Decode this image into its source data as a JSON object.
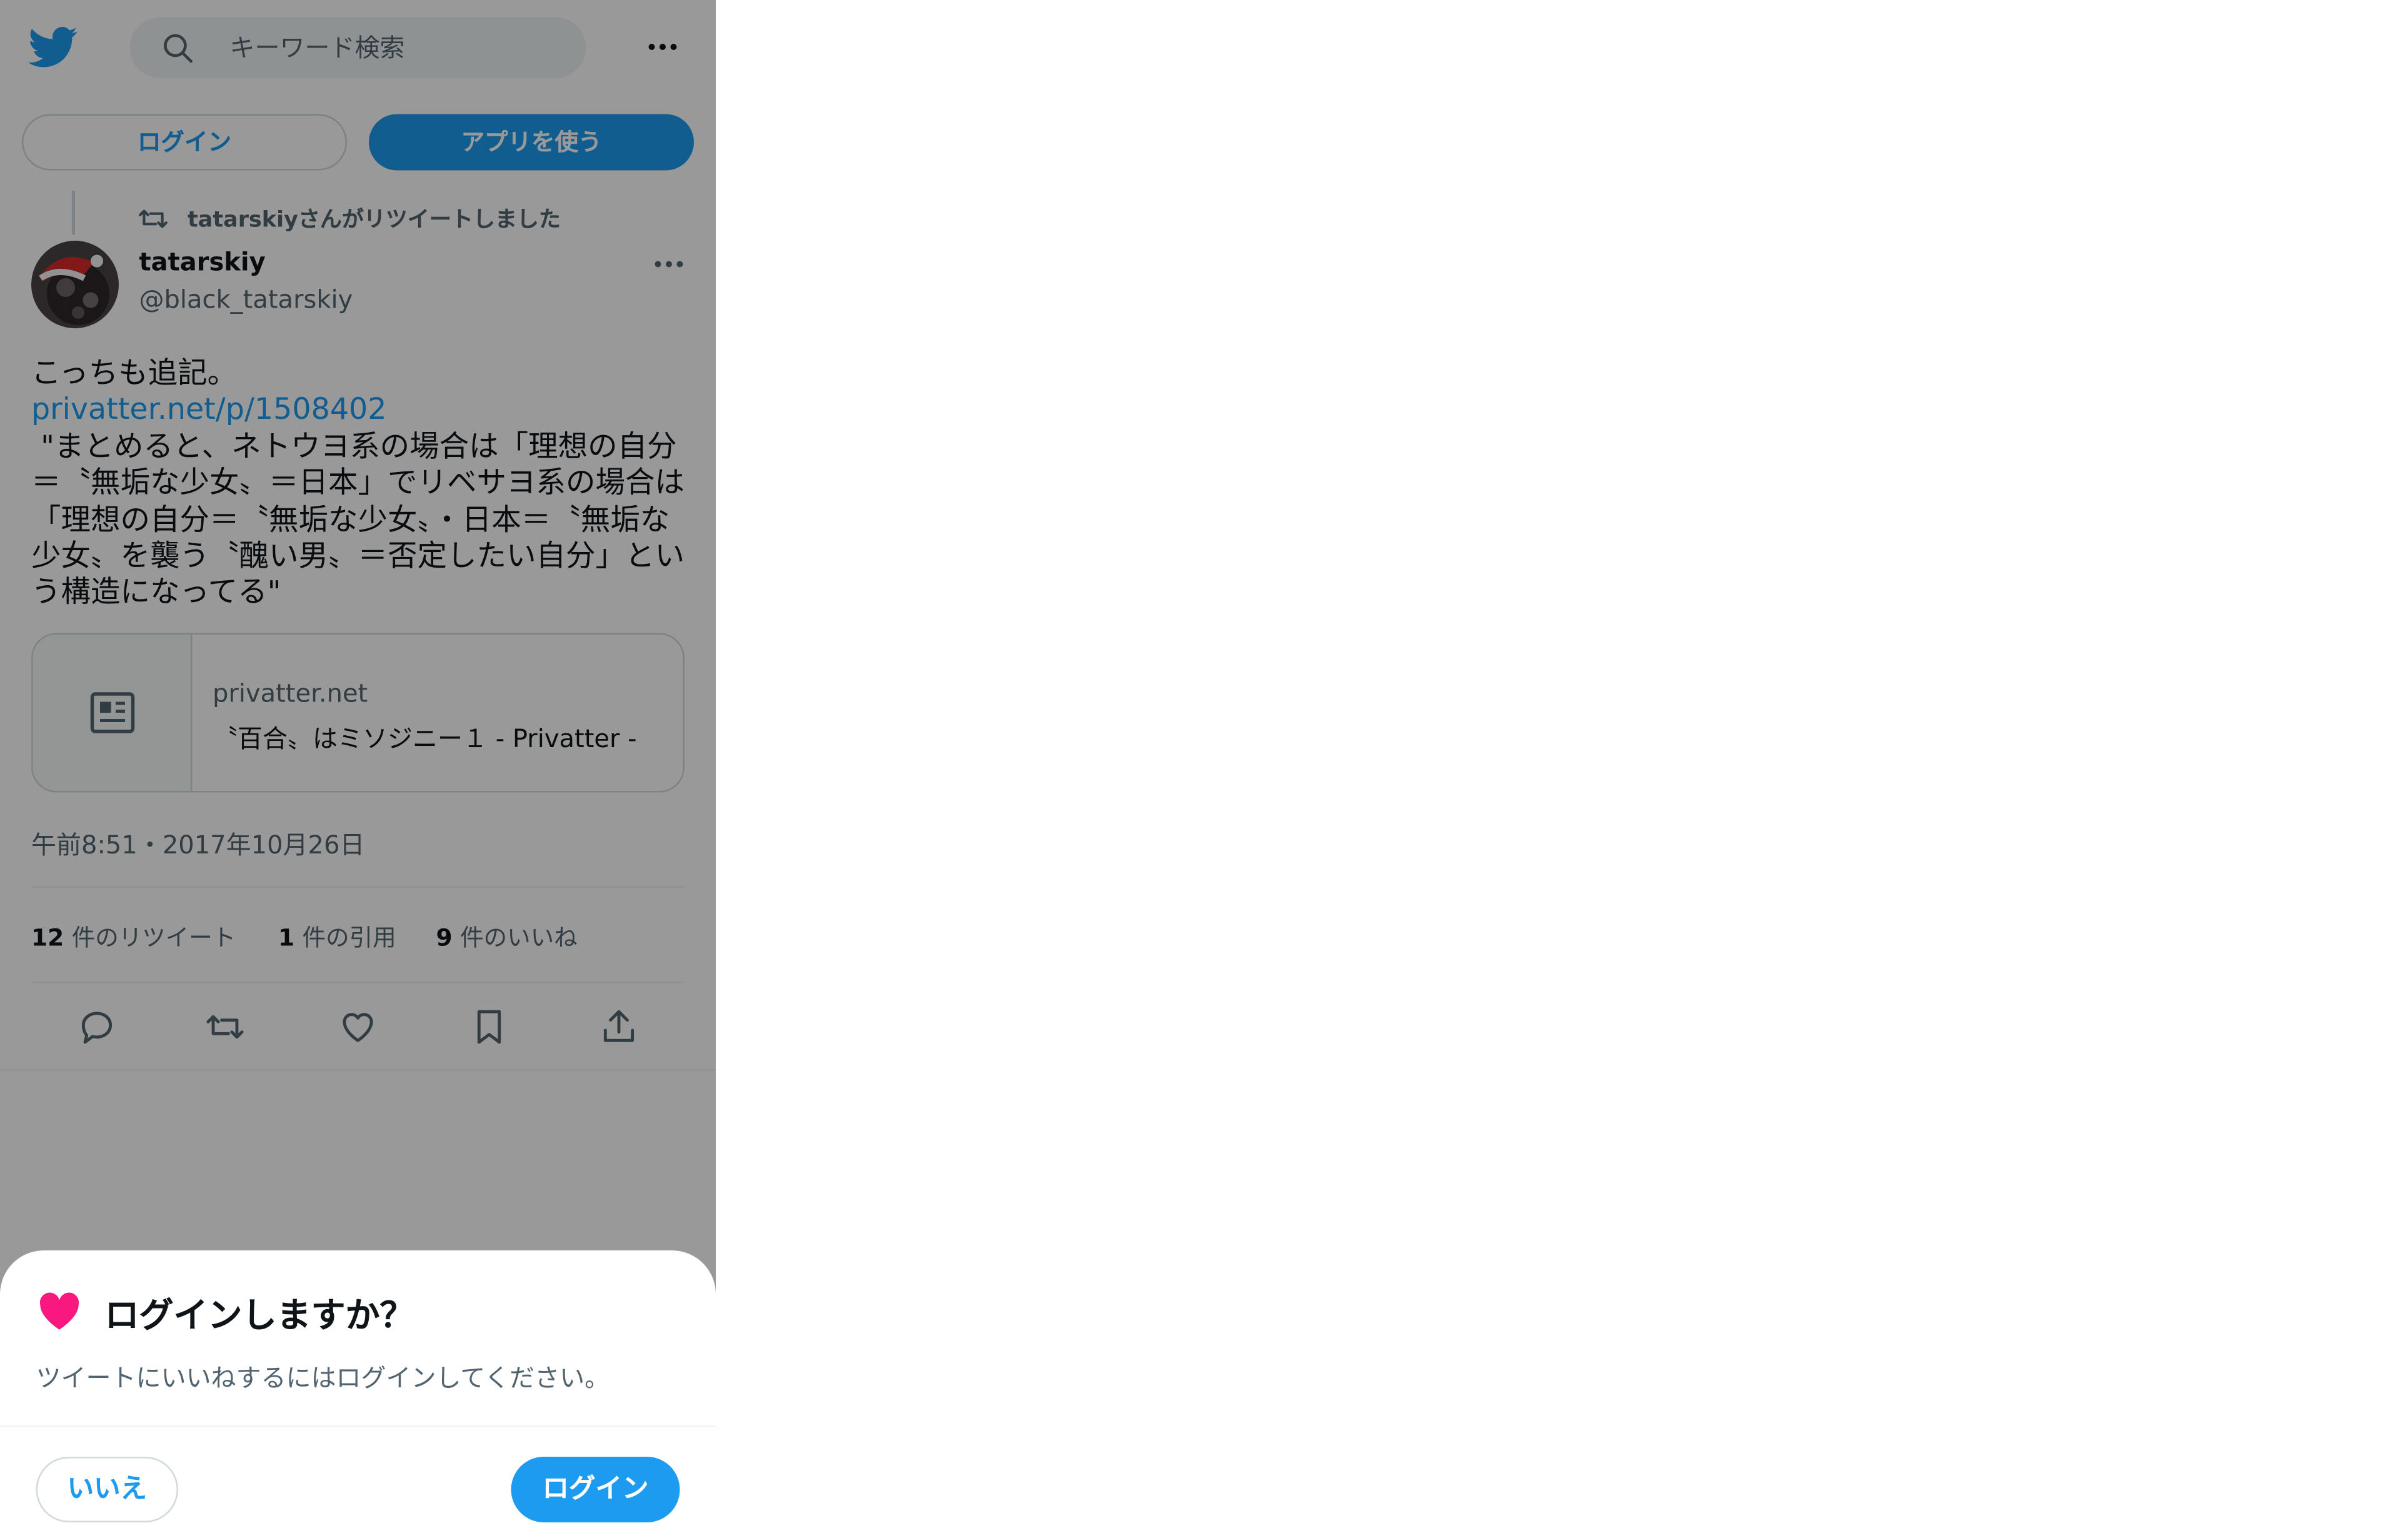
{
  "header": {
    "search_placeholder": "キーワード検索",
    "login_label": "ログイン",
    "app_label": "アプリを使う"
  },
  "tweet": {
    "retweet_context": "tatarskiyさんがリツイートしました",
    "author_name": "tatarskiy",
    "author_handle": "@black_tatarskiy",
    "text_lead": "こっちも追記。",
    "link": "privatter.net/p/1508402",
    "quote": " \"まとめると、ネトウヨ系の場合は「理想の自分＝〝無垢な少女〟＝日本」でリベサヨ系の場合は「理想の自分＝〝無垢な少女〟・日本＝〝無垢な少女〟を襲う〝醜い男〟＝否定したい自分」という構造になってる\"",
    "card": {
      "domain": "privatter.net",
      "title": "〝百合〟はミソジニー１ - Privatter -"
    },
    "timestamp": "午前8:51・2017年10月26日",
    "stats": {
      "retweets_num": "12",
      "retweets_label": "件のリツイート",
      "quotes_num": "1",
      "quotes_label": "件の引用",
      "likes_num": "9",
      "likes_label": "件のいいね"
    }
  },
  "sheet": {
    "title": "ログインしますか？",
    "description": "ツイートにいいねするにはログインしてください。",
    "no_label": "いいえ",
    "login_label": "ログイン"
  },
  "colors": {
    "accent": "#1d9bf0",
    "heart": "#f91880",
    "overlay": "rgba(0,0,0,0.4)"
  },
  "icons": [
    "twitter-bird-icon",
    "search-icon",
    "more-icon",
    "retweet-icon",
    "article-icon",
    "reply-icon",
    "like-icon",
    "bookmark-icon",
    "share-icon",
    "heart-icon"
  ]
}
